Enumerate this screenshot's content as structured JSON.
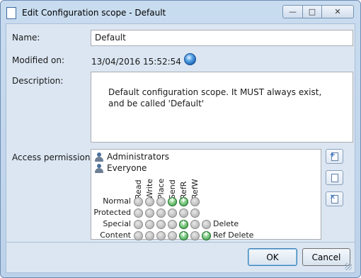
{
  "window": {
    "title": "Edit Configuration scope - Default",
    "minimize_glyph": "—",
    "maximize_glyph": "□",
    "close_glyph": "✕"
  },
  "form": {
    "name_label": "Name:",
    "name_value": "Default",
    "modified_label": "Modified on:",
    "modified_date": "13/04/2016",
    "modified_time": "15:52:54",
    "description_label": "Description:",
    "description_value": "Default configuration scope. It MUST always exist, and be called 'Default'",
    "access_label": "Access permissions:"
  },
  "permissions": {
    "groups": [
      "Administrators",
      "Everyone"
    ],
    "columns": [
      "Read",
      "Write",
      "Place",
      "Send",
      "RefR",
      "RefW"
    ],
    "rows": [
      {
        "label": "Normal",
        "states": [
          false,
          false,
          false,
          true,
          true,
          false
        ],
        "extra_states": [],
        "extra": ""
      },
      {
        "label": "Protected",
        "states": [
          false,
          false,
          false,
          false,
          false,
          false
        ],
        "extra_states": [],
        "extra": ""
      },
      {
        "label": "Special",
        "states": [
          false,
          false,
          false,
          false,
          true,
          false
        ],
        "extra_states": [
          false
        ],
        "extra": "Delete"
      },
      {
        "label": "Content",
        "states": [
          false,
          false,
          false,
          false,
          true,
          false
        ],
        "extra_states": [
          true
        ],
        "extra": "Ref Delete"
      }
    ],
    "side_buttons": [
      {
        "name": "add-permission-button",
        "icon": "document-add-icon",
        "mark": "+",
        "mark_color": "#2f6fc0"
      },
      {
        "name": "edit-permission-button",
        "icon": "document-edit-icon",
        "mark": "",
        "mark_color": "#2f6fc0"
      },
      {
        "name": "remove-permission-button",
        "icon": "document-remove-icon",
        "mark": "✕",
        "mark_color": "#2f6fc0"
      }
    ]
  },
  "buttons": {
    "ok": "OK",
    "cancel": "Cancel"
  },
  "colors": {
    "accent": "#3c7fb1",
    "enabled": "#2e9a3a",
    "disabled": "#a8a8a8"
  }
}
